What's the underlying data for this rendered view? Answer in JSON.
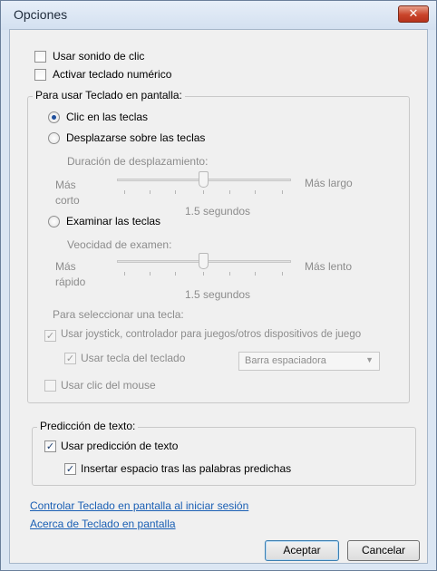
{
  "window": {
    "title": "Opciones",
    "close_glyph": "✕"
  },
  "options": {
    "click_sound": {
      "label": "Usar sonido de clic",
      "checked": false
    },
    "numeric_keypad": {
      "label": "Activar teclado numérico",
      "checked": false
    }
  },
  "osk_group": {
    "title": "Para usar Teclado en pantalla:",
    "click_keys": {
      "label": "Clic en las teclas",
      "selected": true
    },
    "hover_keys": {
      "label": "Desplazarse sobre las teclas",
      "selected": false
    },
    "hover_duration": {
      "label": "Duración de desplazamiento:",
      "min_label": "Más corto",
      "max_label": "Más largo",
      "value": "1.5 segundos"
    },
    "scan_keys": {
      "label": "Examinar las teclas",
      "selected": false
    },
    "scan_speed": {
      "label": "Veocidad de examen:",
      "min_label": "Más rápido",
      "max_label": "Más lento",
      "value": "1.5 segundos"
    },
    "select_key_label": "Para seleccionar una tecla:",
    "use_joystick": {
      "label": "Usar joystick, controlador para juegos/otros dispositivos de juego",
      "checked": true
    },
    "use_keyboard_key": {
      "label": "Usar tecla del teclado",
      "checked": true
    },
    "key_combo": {
      "value": "Barra espaciadora"
    },
    "use_mouse_click": {
      "label": "Usar clic del mouse",
      "checked": false
    }
  },
  "prediction_group": {
    "title": "Predicción de texto:",
    "use_prediction": {
      "label": "Usar predicción de texto",
      "checked": true
    },
    "insert_space": {
      "label": "Insertar espacio tras las palabras predichas",
      "checked": true
    }
  },
  "links": {
    "control_at_login": "Controlar Teclado en pantalla al iniciar sesión",
    "about": "Acerca de Teclado en pantalla"
  },
  "buttons": {
    "ok": "Aceptar",
    "cancel": "Cancelar"
  },
  "colors": {
    "accent": "#1f4f9c",
    "close_button": "#c9442a",
    "link": "#1a5fb4"
  }
}
